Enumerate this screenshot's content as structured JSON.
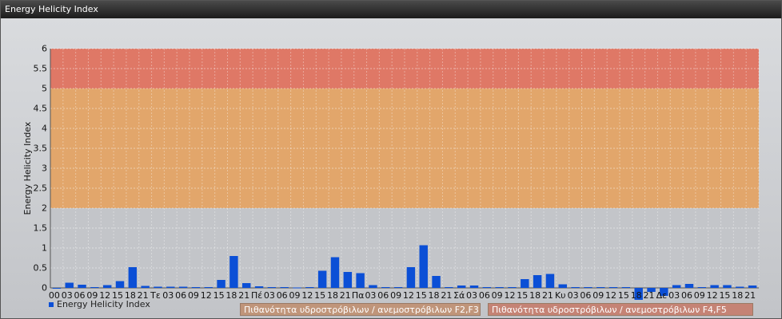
{
  "panel": {
    "title": "Energy Helicity Index"
  },
  "chart_data": {
    "type": "bar",
    "title": "",
    "ylabel": "Energy Helicity Index",
    "xlabel": "",
    "ylim": [
      0,
      6
    ],
    "yticks": [
      "0",
      "0.5",
      "1",
      "1.5",
      "2",
      "2.5",
      "3",
      "3.5",
      "4",
      "4.5",
      "5",
      "5.5",
      "6"
    ],
    "xtick_labels": [
      "00",
      "03",
      "06",
      "09",
      "12",
      "15",
      "18",
      "21",
      "Τε",
      "03",
      "06",
      "09",
      "12",
      "15",
      "18",
      "21",
      "Πέ",
      "03",
      "06",
      "09",
      "12",
      "15",
      "18",
      "21",
      "Πα",
      "03",
      "06",
      "09",
      "12",
      "15",
      "18",
      "21",
      "Σά",
      "03",
      "06",
      "09",
      "12",
      "15",
      "18",
      "21",
      "Κυ",
      "03",
      "06",
      "09",
      "12",
      "15",
      "18",
      "21",
      "Δε",
      "03",
      "06",
      "09",
      "12",
      "15",
      "18",
      "21"
    ],
    "series": [
      {
        "name": "Energy Helicity Index",
        "color": "#0b4fd6",
        "values": [
          0.0,
          0.13,
          0.08,
          0.02,
          0.07,
          0.17,
          0.52,
          0.05,
          0.03,
          0.03,
          0.03,
          0.02,
          0.02,
          0.2,
          0.8,
          0.12,
          0.04,
          0.02,
          0.02,
          0.01,
          0.02,
          0.43,
          0.77,
          0.4,
          0.37,
          0.07,
          0.02,
          0.02,
          0.52,
          1.07,
          0.3,
          0.02,
          0.06,
          0.06,
          0.02,
          0.02,
          0.02,
          0.22,
          0.32,
          0.35,
          0.09,
          0.02,
          0.02,
          0.02,
          0.02,
          0.02,
          -0.3,
          -0.1,
          -0.2,
          0.07,
          0.1,
          0.02,
          0.07,
          0.07,
          0.03,
          0.06
        ]
      }
    ],
    "bands": [
      {
        "from": 2,
        "to": 5,
        "color": "#e8a05a",
        "label": "Πιθανότητα υδροστρόβιλων / ανεμοστρόβιλων F2,F3"
      },
      {
        "from": 5,
        "to": 6,
        "color": "#e46a55",
        "label": "Πιθανότητα υδροστρόβιλων / ανεμοστρόβιλων F4,F5"
      }
    ],
    "grid": true,
    "legend": "bottom-left"
  }
}
